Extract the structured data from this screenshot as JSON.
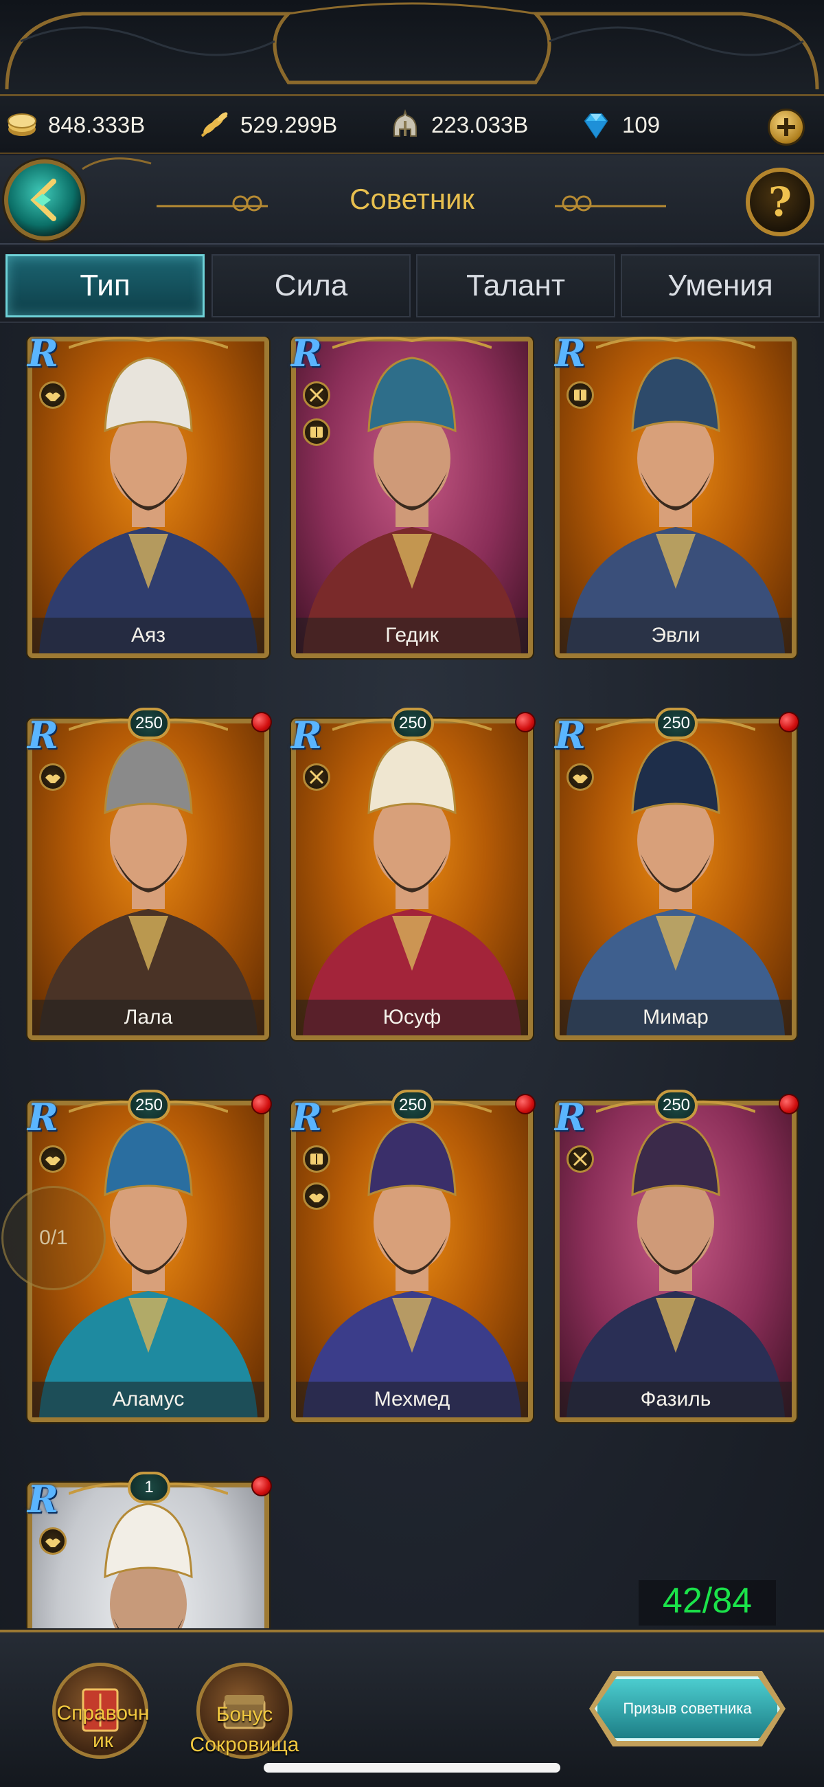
{
  "resources": [
    {
      "name": "gold",
      "value": "848.333B",
      "icon": "coins-icon"
    },
    {
      "name": "grain",
      "value": "529.299B",
      "icon": "wheat-icon"
    },
    {
      "name": "troops",
      "value": "223.033B",
      "icon": "helmet-icon"
    },
    {
      "name": "gems",
      "value": "109",
      "icon": "diamond-icon"
    }
  ],
  "header": {
    "title": "Советник"
  },
  "tabs": [
    {
      "label": "Тип",
      "active": true
    },
    {
      "label": "Сила",
      "active": false
    },
    {
      "label": "Талант",
      "active": false
    },
    {
      "label": "Умения",
      "active": false
    }
  ],
  "advisors": [
    {
      "name": "Аяз",
      "rarity": "R",
      "level": "",
      "bg": "orange",
      "icons": [
        "handshake-icon"
      ],
      "dot": false
    },
    {
      "name": "Гедик",
      "rarity": "R",
      "level": "",
      "bg": "magenta",
      "icons": [
        "swords-icon",
        "book-icon"
      ],
      "dot": false
    },
    {
      "name": "Эвли",
      "rarity": "R",
      "level": "",
      "bg": "orange",
      "icons": [
        "book-icon"
      ],
      "dot": false
    },
    {
      "name": "Лала",
      "rarity": "R",
      "level": "250",
      "bg": "orange",
      "icons": [
        "handshake-icon"
      ],
      "dot": true
    },
    {
      "name": "Юсуф",
      "rarity": "R",
      "level": "250",
      "bg": "orange",
      "icons": [
        "swords-icon"
      ],
      "dot": true
    },
    {
      "name": "Мимар",
      "rarity": "R",
      "level": "250",
      "bg": "orange",
      "icons": [
        "handshake-icon"
      ],
      "dot": true
    },
    {
      "name": "Аламус",
      "rarity": "R",
      "level": "250",
      "bg": "orange",
      "icons": [
        "handshake-icon"
      ],
      "dot": true
    },
    {
      "name": "Мехмед",
      "rarity": "R",
      "level": "250",
      "bg": "orange",
      "icons": [
        "book-icon",
        "handshake-icon"
      ],
      "dot": true
    },
    {
      "name": "Фазиль",
      "rarity": "R",
      "level": "250",
      "bg": "magenta",
      "icons": [
        "swords-icon"
      ],
      "dot": true
    },
    {
      "name": "",
      "rarity": "R",
      "level": "1",
      "bg": "white",
      "icons": [
        "handshake-icon"
      ],
      "dot": true
    }
  ],
  "side_counter": "0/1",
  "count": "42/84",
  "bottom": {
    "handbook_label": "Справочн\nик",
    "bonus_label": "Бонус",
    "treasure_label": "Сокровища",
    "summon_label": "Призыв советника"
  },
  "colors": {
    "accent_gold": "#e7bf4f",
    "tab_active": "#1b6471",
    "count_green": "#1be34a",
    "rarity_blue": "#5ab5ff"
  }
}
